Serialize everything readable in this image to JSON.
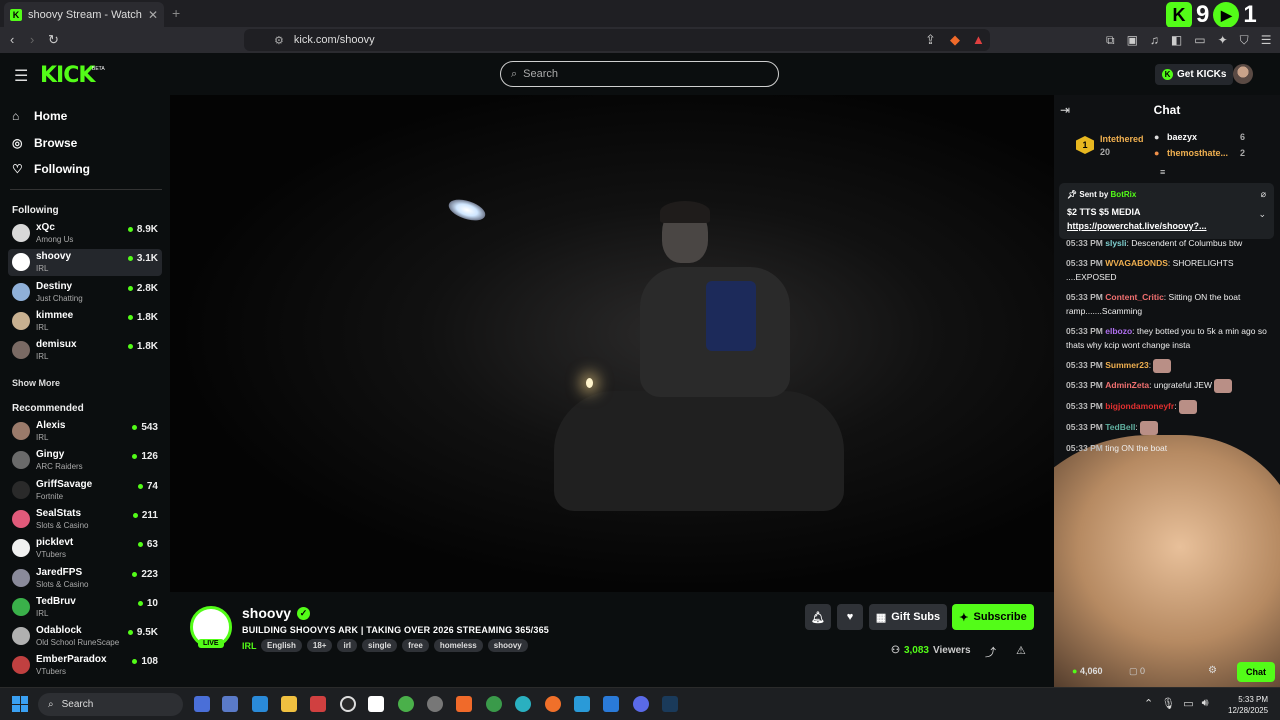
{
  "browser": {
    "tab_title": "shoovy Stream - Watch Live o",
    "tab_close": "✕",
    "new_tab": "+",
    "url": "kick.com/shoovy",
    "overlay_left": "9",
    "overlay_right": "1"
  },
  "header": {
    "logo": "KICK",
    "logo_badge": "BETA",
    "search_placeholder": "Search",
    "get_kicks": "Get KICKs"
  },
  "sidebar": {
    "nav": [
      {
        "label": "Home",
        "icon": "home-icon"
      },
      {
        "label": "Browse",
        "icon": "compass-icon"
      },
      {
        "label": "Following",
        "icon": "heart-icon"
      }
    ],
    "following_title": "Following",
    "following": [
      {
        "name": "xQc",
        "category": "Among Us",
        "viewers": "8.9K",
        "color": "#d8d8d8"
      },
      {
        "name": "shoovy",
        "category": "IRL",
        "viewers": "3.1K",
        "color": "#ffffff"
      },
      {
        "name": "Destiny",
        "category": "Just Chatting",
        "viewers": "2.8K",
        "color": "#8fb0d8"
      },
      {
        "name": "kimmee",
        "category": "IRL",
        "viewers": "1.8K",
        "color": "#c8b090"
      },
      {
        "name": "demisux",
        "category": "IRL",
        "viewers": "1.8K",
        "color": "#7a6a64"
      }
    ],
    "show_more": "Show More",
    "recommended_title": "Recommended",
    "recommended": [
      {
        "name": "Alexis",
        "category": "IRL",
        "viewers": "543",
        "color": "#9a7a6a"
      },
      {
        "name": "Gingy",
        "category": "ARC Raiders",
        "viewers": "126",
        "color": "#6a6a6a"
      },
      {
        "name": "GriffSavage",
        "category": "Fortnite",
        "viewers": "74",
        "color": "#2a2a2a"
      },
      {
        "name": "SealStats",
        "category": "Slots & Casino",
        "viewers": "211",
        "color": "#e05a7a"
      },
      {
        "name": "picklevt",
        "category": "VTubers",
        "viewers": "63",
        "color": "#f0f0f0"
      },
      {
        "name": "JaredFPS",
        "category": "Slots & Casino",
        "viewers": "223",
        "color": "#8a8a9a"
      },
      {
        "name": "TedBruv",
        "category": "IRL",
        "viewers": "10",
        "color": "#3ab04a"
      },
      {
        "name": "Odablock",
        "category": "Old School RuneScape",
        "viewers": "9.5K",
        "color": "#b0b0b0"
      },
      {
        "name": "EmberParadox",
        "category": "VTubers",
        "viewers": "108",
        "color": "#c04040"
      }
    ]
  },
  "stream": {
    "name": "shoovy",
    "live": "LIVE",
    "title": "BUILDING SHOOVYS ARK | TAKING OVER 2026 STREAMING 365/365",
    "category": "IRL",
    "tags": [
      "English",
      "18+",
      "irl",
      "single",
      "free",
      "homeless",
      "shoovy"
    ],
    "gift_subs": "Gift Subs",
    "subscribe": "Subscribe",
    "viewers": "3,083",
    "viewers_label": "Viewers"
  },
  "chat": {
    "title": "Chat",
    "leaderboard": {
      "rank": "1",
      "first_name": "Intethered",
      "first_value": "20",
      "second_name": "baezyx",
      "second_value": "6",
      "third_name": "themosthate...",
      "third_value": "2"
    },
    "pinned": {
      "sent_by": "Sent by",
      "bot": "BotRix",
      "message": "$2 TTS $5 MEDIA",
      "link": "https://powerchat.live/shoovy?..."
    },
    "messages": [
      {
        "time": "05:33 PM",
        "user": "slysli",
        "color": "#7fd0d0",
        "text": ": Descendent of Columbus btw",
        "emote": false
      },
      {
        "time": "05:33 PM",
        "user": "WVAGABONDS",
        "color": "#f0b050",
        "text": ": SHORELIGHTS ....EXPOSED",
        "emote": false
      },
      {
        "time": "05:33 PM",
        "user": "Content_Critic",
        "color": "#f07070",
        "text": ": Sitting ON the boat ramp.......Scamming",
        "emote": false
      },
      {
        "time": "05:33 PM",
        "user": "elbozo",
        "color": "#b070f0",
        "text": ": they botted you to 5k a min ago so thats why kcip wont change insta",
        "emote": false
      },
      {
        "time": "05:33 PM",
        "user": "Summer23",
        "color": "#f0b050",
        "text": ":",
        "emote": true
      },
      {
        "time": "05:33 PM",
        "user": "AdminZeta",
        "color": "#f07070",
        "text": ": ungrateful JEW",
        "emote": true
      },
      {
        "time": "05:33 PM",
        "user": "bigjondamoneyfr",
        "color": "#e03030",
        "text": ":",
        "emote": true
      },
      {
        "time": "05:33 PM",
        "user": "TedBell",
        "color": "#60b0a0",
        "text": ":",
        "emote": true
      },
      {
        "time": "05:33 PM",
        "user": "",
        "color": "#aaaaaa",
        "text": "ting ON the boat",
        "emote": false
      }
    ],
    "kicks_count": "4,060",
    "gift_count": "0",
    "send": "Chat"
  },
  "taskbar": {
    "search": "Search",
    "time": "5:33 PM",
    "date": "12/28/2025"
  },
  "colors": {
    "accent": "#53fc18",
    "background": "#0b0e0f"
  }
}
